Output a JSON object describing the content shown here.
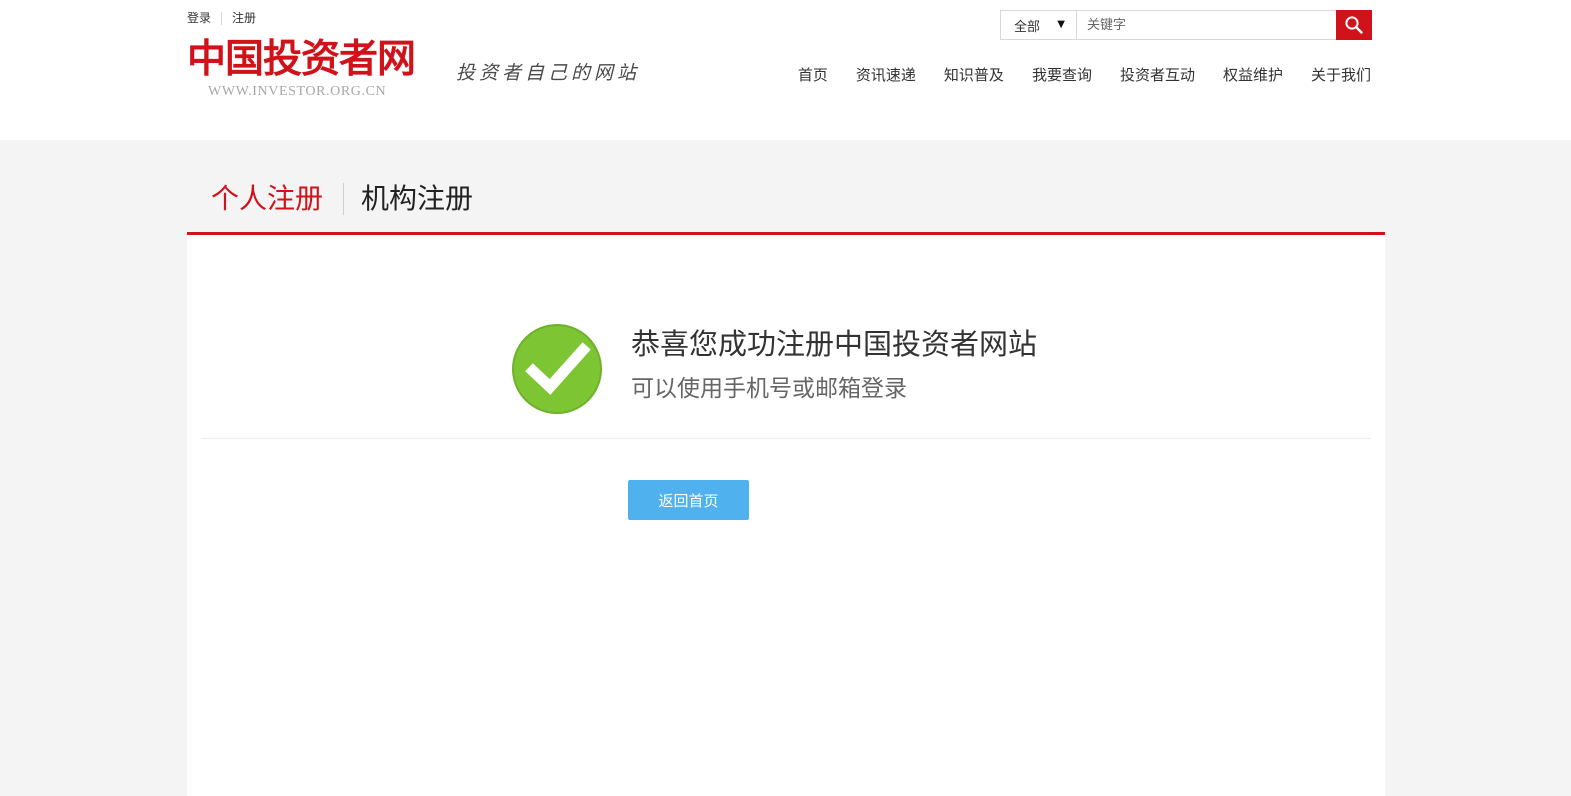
{
  "top_links": {
    "login": "登录",
    "register": "注册"
  },
  "logo": {
    "main_text": "中国投资者网",
    "url_text": "WWW.INVESTOR.ORG.CN",
    "slogan": "投资者自己的网站"
  },
  "search": {
    "category": "全部",
    "placeholder": "关键字"
  },
  "nav": {
    "items": [
      {
        "label": "首页"
      },
      {
        "label": "资讯速递"
      },
      {
        "label": "知识普及"
      },
      {
        "label": "我要查询"
      },
      {
        "label": "投资者互动"
      },
      {
        "label": "权益维护"
      },
      {
        "label": "关于我们"
      }
    ]
  },
  "tabs": {
    "personal": "个人注册",
    "institution": "机构注册"
  },
  "success": {
    "title": "恭喜您成功注册中国投资者网站",
    "subtitle": "可以使用手机号或邮箱登录",
    "home_button": "返回首页"
  },
  "colors": {
    "brand_red": "#d0121b",
    "button_blue": "#4fb1ee",
    "success_green": "#7ec533",
    "page_bg": "#f4f4f4"
  },
  "icons": {
    "search": "search-icon",
    "success": "check-circle-icon",
    "dropdown": "caret-down-icon"
  }
}
